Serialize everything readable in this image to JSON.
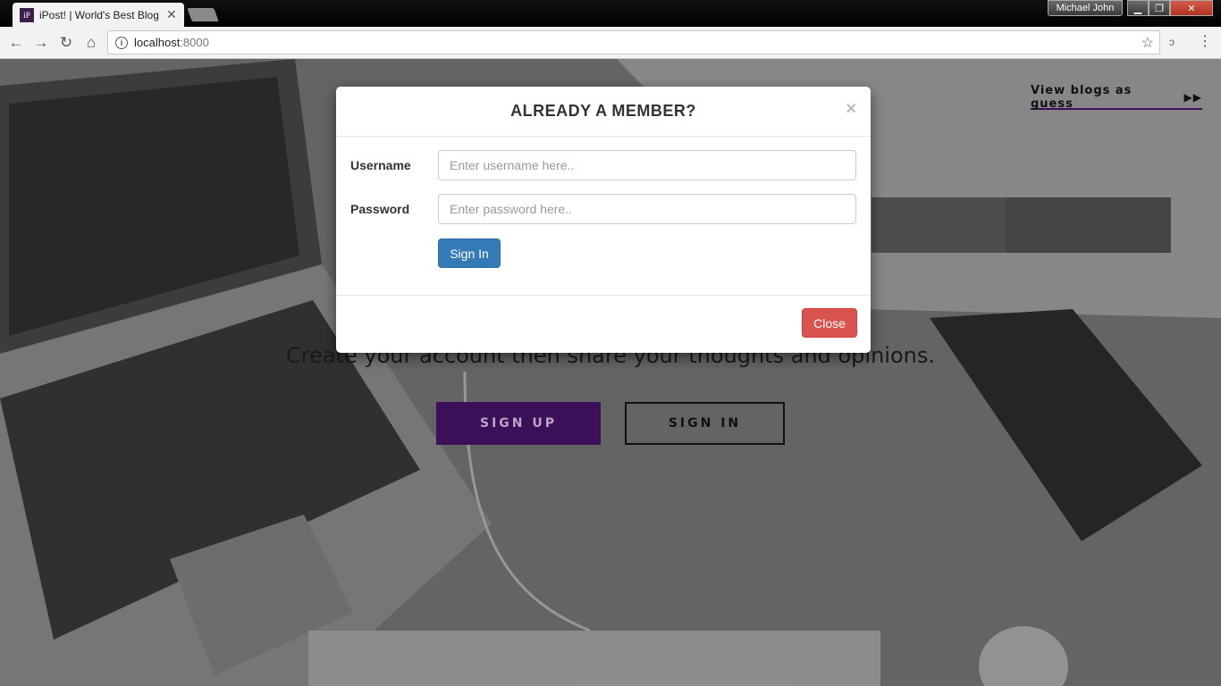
{
  "browser": {
    "tab_title": "iPost! | World's Best Blog",
    "tab_favicon": "iP",
    "profile_name": "Michael John",
    "url_host": "localhost",
    "url_port": ":8000"
  },
  "page": {
    "guest_link": "View blogs as guess",
    "tagline": "Create your account then share your thoughts and opinions.",
    "signup_label": "SIGN UP",
    "signin_label": "SIGN IN",
    "accent_color": "#3b1058"
  },
  "modal": {
    "title": "ALREADY A MEMBER?",
    "username_label": "Username",
    "username_placeholder": "Enter username here..",
    "password_label": "Password",
    "password_placeholder": "Enter password here..",
    "submit_label": "Sign In",
    "close_label": "Close",
    "close_x": "×"
  },
  "icons": {
    "back": "back-arrow-icon",
    "forward": "forward-arrow-icon",
    "reload": "reload-icon",
    "home": "home-icon",
    "info": "info-icon",
    "star": "bookmark-star-icon",
    "menu": "kebab-menu-icon",
    "fast_forward": "fast-forward-icon"
  }
}
